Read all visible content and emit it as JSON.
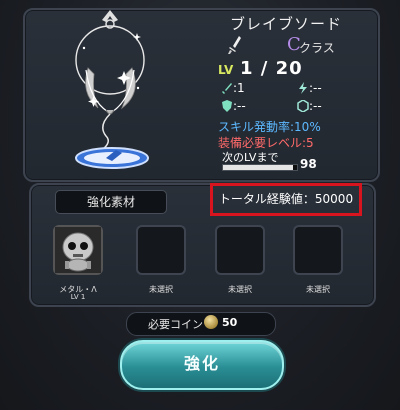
{
  "weapon": {
    "name": "ブレイブソード",
    "class_symbol": "C",
    "class_label": "クラス",
    "level_prefix": "LV",
    "level_value": "1 / 20",
    "stat_attack": ":1",
    "stat_2": ":--",
    "stat_3": ":--",
    "stat_4": ":--",
    "skill_rate": "スキル発動率:10%",
    "required_level": "装備必要レベル:5",
    "next_lv_label": "次のLVまで",
    "next_lv_value": "98",
    "xp_progress": 0.95
  },
  "materials": {
    "label": "強化素材",
    "total_exp": "トータル経験値：50000",
    "slots": [
      {
        "label": "メタル・Λ",
        "sub": "LV 1"
      },
      {
        "label": "未選択",
        "sub": ""
      },
      {
        "label": "未選択",
        "sub": ""
      },
      {
        "label": "未選択",
        "sub": ""
      }
    ]
  },
  "coin": {
    "label": "必要コイン",
    "value": "50"
  },
  "enhance_button": "強化",
  "colors": {
    "accent_teal": "#3fb4b8",
    "highlight_red": "#d8141e",
    "skill_blue": "#5cb8ff",
    "req_red": "#ff6a6a",
    "class_purple": "#b48be8",
    "lv_yellow": "#d8e860"
  }
}
